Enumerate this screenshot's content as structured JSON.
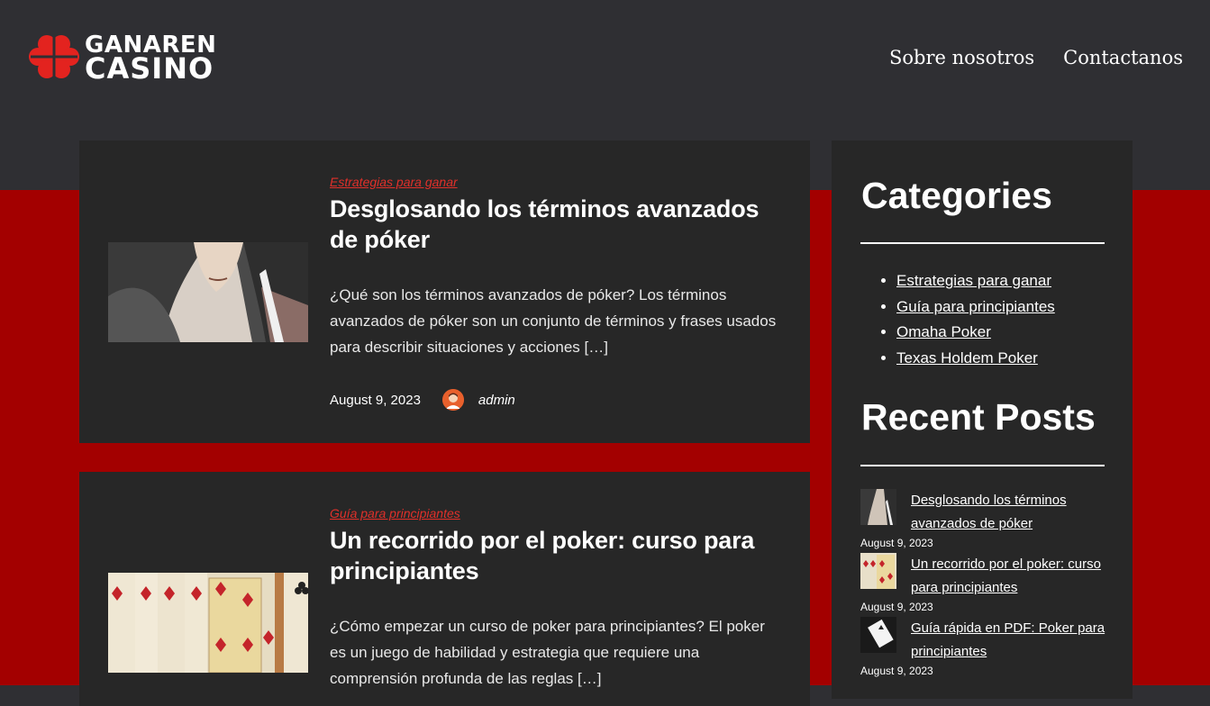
{
  "header": {
    "logo_line1": "GANAREN",
    "logo_line2": "CASINO",
    "nav": [
      "Sobre nosotros",
      "Contactanos"
    ]
  },
  "posts": [
    {
      "category": "Estrategias para ganar",
      "title": "Desglosando los términos avanzados de póker",
      "excerpt": "¿Qué son los términos avanzados de póker? Los términos avanzados de póker son un conjunto de términos y frases usados para describir situaciones y acciones […]",
      "date": "August 9, 2023",
      "author": "admin"
    },
    {
      "category": "Guía para principiantes",
      "title": "Un recorrido por el poker: curso para principiantes",
      "excerpt": "¿Cómo empezar un curso de poker para principiantes? El poker es un juego de habilidad y estrategia que requiere una comprensión profunda de las reglas […]"
    }
  ],
  "sidebar": {
    "categories_title": "Categories",
    "categories": [
      "Estrategias para ganar",
      "Guía para principiantes",
      "Omaha Poker",
      "Texas Holdem Poker"
    ],
    "recent_title": "Recent Posts",
    "recent": [
      {
        "title": "Desglosando los términos avanzados de póker",
        "date": "August 9, 2023"
      },
      {
        "title": "Un recorrido por el poker: curso para principiantes",
        "date": "August 9, 2023"
      },
      {
        "title": "Guía rápida en PDF: Poker para principiantes",
        "date": "August 9, 2023"
      }
    ]
  },
  "colors": {
    "header_bg": "#2f2f33",
    "page_bg": "#a30000",
    "card_bg": "#272727",
    "accent": "#e0302a"
  }
}
